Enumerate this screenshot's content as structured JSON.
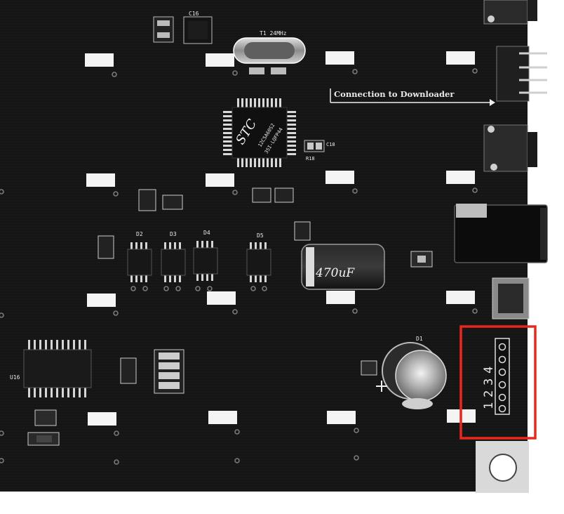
{
  "board": {
    "connection_label": "Connection to Downloader",
    "mcu_text": [
      "STC",
      "12C5A60S2",
      "35I-LQFP44"
    ],
    "crystal_label": "T1 24MHz",
    "capacitor_label": "470uF",
    "header_numbers": [
      "1",
      "2",
      "3",
      "4"
    ],
    "refs": {
      "c16": "C16",
      "d2": "D2",
      "d3": "D3",
      "d4": "D4",
      "d5": "D5",
      "d1": "D1",
      "u16": "U16",
      "c18": "C18",
      "r18": "R18"
    }
  },
  "highlight": {
    "color": "#e8281e",
    "target": "4-pin header"
  },
  "colors": {
    "pcb": "#141414",
    "silkscreen": "#e9e9e9",
    "pad": "#c9c9c9"
  }
}
